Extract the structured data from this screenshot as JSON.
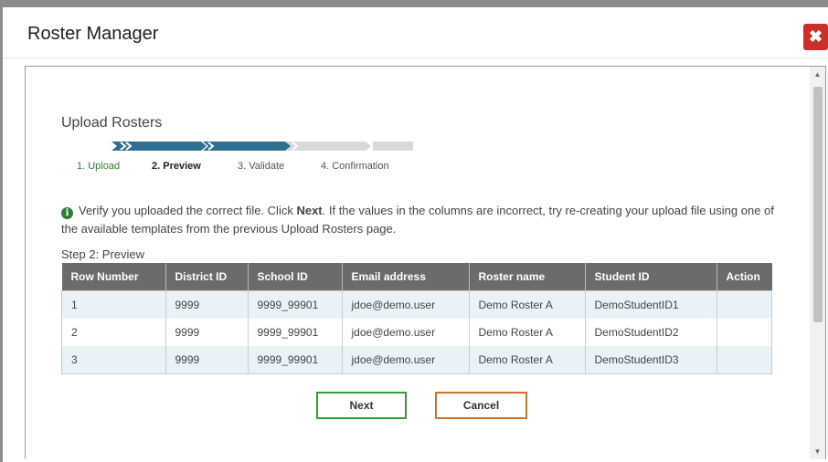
{
  "dialog": {
    "title": "Roster Manager",
    "close_icon": "close-icon"
  },
  "content": {
    "section_title": "Upload Rosters",
    "steps": [
      {
        "label": "1. Upload",
        "state": "completed",
        "color": "#2e7d32"
      },
      {
        "label": "2. Preview",
        "state": "current",
        "color": "#222222"
      },
      {
        "label": "3. Validate",
        "state": "upcoming",
        "color": "#555555"
      },
      {
        "label": "4. Confirmation",
        "state": "upcoming",
        "color": "#555555"
      }
    ],
    "info": {
      "icon": "info-icon",
      "text_before": "Verify you uploaded the correct file. Click ",
      "bold": "Next",
      "text_after": ". If the values in the columns are incorrect, try re-creating your upload file using one of the available templates from the previous Upload Rosters page."
    },
    "step_heading": "Step 2: Preview",
    "table": {
      "headers": [
        "Row Number",
        "District ID",
        "School ID",
        "Email address",
        "Roster name",
        "Student ID",
        "Action"
      ],
      "rows": [
        [
          "1",
          "9999",
          "9999_99901",
          "jdoe@demo.user",
          "Demo Roster A",
          "DemoStudentID1",
          ""
        ],
        [
          "2",
          "9999",
          "9999_99901",
          "jdoe@demo.user",
          "Demo Roster A",
          "DemoStudentID2",
          ""
        ],
        [
          "3",
          "9999",
          "9999_99901",
          "jdoe@demo.user",
          "Demo Roster A",
          "DemoStudentID3",
          ""
        ]
      ]
    },
    "buttons": {
      "next": "Next",
      "cancel": "Cancel"
    }
  },
  "colors": {
    "progress_active": "#2f6f8f",
    "progress_inactive": "#d9d9d9",
    "close": "#c9302c",
    "next_border": "#3a9b3a",
    "cancel_border": "#c9762e"
  }
}
